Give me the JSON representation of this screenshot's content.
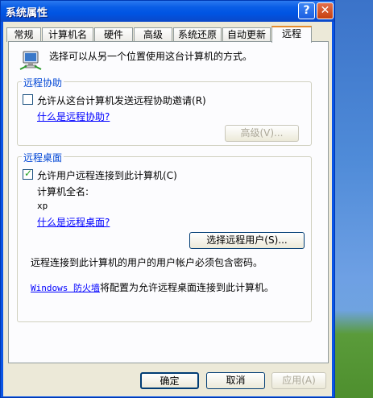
{
  "window": {
    "title": "系统属性"
  },
  "tabs": [
    "常规",
    "计算机名",
    "硬件",
    "高级",
    "系统还原",
    "自动更新",
    "远程"
  ],
  "intro": {
    "text": "选择可以从另一个位置使用这台计算机的方式。"
  },
  "remote_assistance": {
    "title": "远程协助",
    "checkbox_label": "允许从这台计算机发送远程协助邀请",
    "checkbox_hotkey": "(R)",
    "checked": false,
    "help_link": "什么是远程协助?",
    "advanced_button": "高级(V)..."
  },
  "remote_desktop": {
    "title": "远程桌面",
    "checkbox_label": "允许用户远程连接到此计算机",
    "checkbox_hotkey": "(C)",
    "checked": true,
    "full_name_label": "计算机全名:",
    "full_name_value": "xp",
    "help_link": "什么是远程桌面?",
    "select_users_button": "选择远程用户(S)...",
    "password_note": "远程连接到此计算机的用户的用户帐户必须包含密码。",
    "firewall_link": "Windows 防火墙",
    "firewall_text": "将配置为允许远程桌面连接到此计算机。"
  },
  "footer": {
    "ok": "确定",
    "cancel": "取消",
    "apply": "应用(A)"
  }
}
